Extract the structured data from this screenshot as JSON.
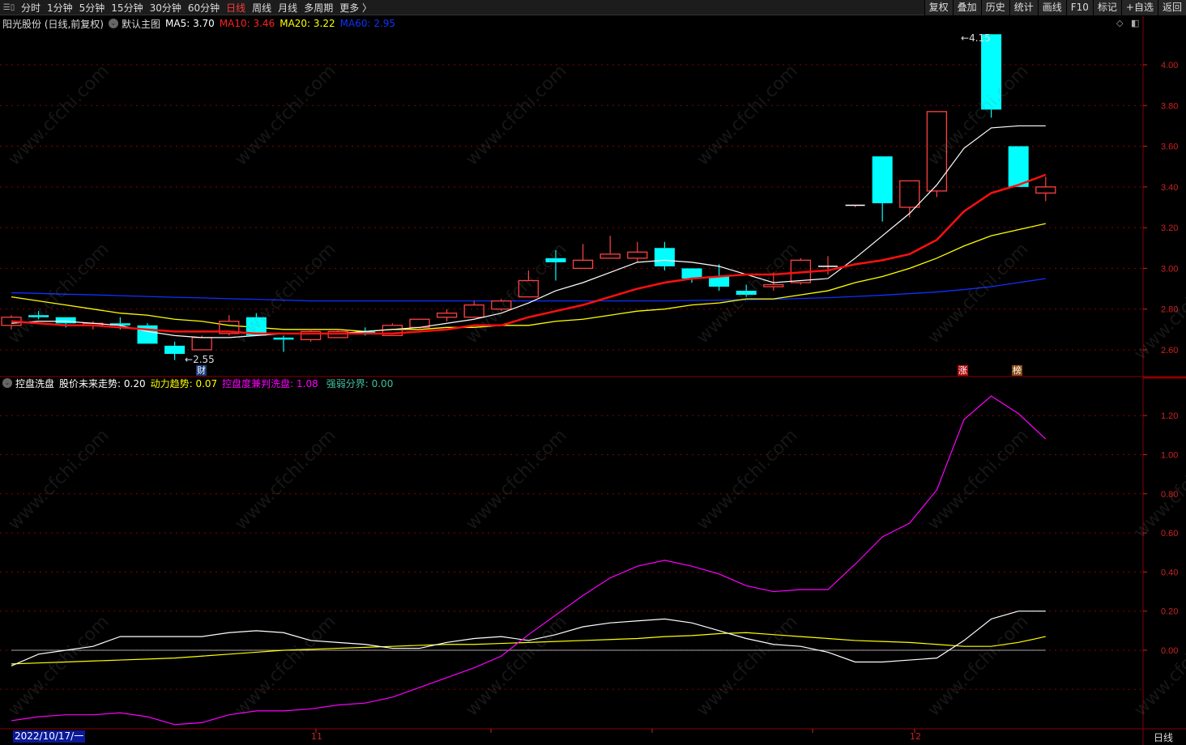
{
  "toolbar": {
    "left": [
      "分时",
      "1分钟",
      "5分钟",
      "15分钟",
      "30分钟",
      "60分钟",
      "日线",
      "周线",
      "月线",
      "多周期",
      "更多 〉"
    ],
    "active": "日线",
    "right": [
      "复权",
      "叠加",
      "历史",
      "统计",
      "画线",
      "F10",
      "标记",
      "+自选",
      "返回"
    ]
  },
  "main": {
    "title": "阳光股份 (日线,前复权)",
    "template": "默认主图",
    "ma": [
      {
        "label": "MA5: 3.70",
        "color": "#ffffff"
      },
      {
        "label": "MA10: 3.46",
        "color": "#ff2020"
      },
      {
        "label": "MA20: 3.22",
        "color": "#ffff00"
      },
      {
        "label": "MA60: 2.95",
        "color": "#1030ff"
      }
    ],
    "y_ticks": [
      "4.00",
      "3.80",
      "3.60",
      "3.40",
      "3.20",
      "3.00",
      "2.80",
      "2.60"
    ],
    "low_marker": "2.55",
    "high_marker": "4.15",
    "badges": [
      {
        "text": "财",
        "color": "#1a3a7a"
      },
      {
        "text": "涨",
        "color": "#b01010"
      },
      {
        "text": "榜",
        "color": "#8a4a10"
      }
    ]
  },
  "sub": {
    "title": "控盘洗盘",
    "items": [
      {
        "label": "股价未来走势: 0.20",
        "color": "#ffffff"
      },
      {
        "label": "动力趋势: 0.07",
        "color": "#ffff00"
      },
      {
        "label": "控盘度兼判洗盘: 1.08",
        "color": "#ff00ff"
      },
      {
        "label": "强弱分界: 0.00",
        "color": "#40c0a0"
      }
    ],
    "y_ticks": [
      "1.20",
      "1.00",
      "0.80",
      "0.60",
      "0.40",
      "0.20",
      "0.00"
    ]
  },
  "xaxis": {
    "date": "2022/10/17/一",
    "months": [
      "11",
      "12"
    ],
    "period": "日线"
  },
  "watermark": "www.cfchi.com",
  "colors": {
    "up": "#ff4040",
    "down": "#00ffff",
    "grid": "#8b0000"
  },
  "chart_data": {
    "type": "candlestick",
    "candles": [
      [
        2.72,
        2.76,
        2.77,
        2.7
      ],
      [
        2.77,
        2.76,
        2.79,
        2.75
      ],
      [
        2.76,
        2.73,
        2.76,
        2.71
      ],
      [
        2.72,
        2.73,
        2.74,
        2.7
      ],
      [
        2.73,
        2.72,
        2.76,
        2.7
      ],
      [
        2.72,
        2.63,
        2.73,
        2.63
      ],
      [
        2.62,
        2.58,
        2.64,
        2.55
      ],
      [
        2.6,
        2.66,
        2.67,
        2.6
      ],
      [
        2.68,
        2.74,
        2.77,
        2.67
      ],
      [
        2.76,
        2.67,
        2.78,
        2.67
      ],
      [
        2.66,
        2.65,
        2.67,
        2.59
      ],
      [
        2.65,
        2.69,
        2.7,
        2.64
      ],
      [
        2.66,
        2.69,
        2.7,
        2.66
      ],
      [
        2.69,
        2.68,
        2.71,
        2.67
      ],
      [
        2.67,
        2.72,
        2.73,
        2.67
      ],
      [
        2.71,
        2.75,
        2.75,
        2.7
      ],
      [
        2.76,
        2.78,
        2.8,
        2.74
      ],
      [
        2.76,
        2.82,
        2.84,
        2.76
      ],
      [
        2.8,
        2.84,
        2.85,
        2.79
      ],
      [
        2.86,
        2.94,
        2.99,
        2.86
      ],
      [
        3.05,
        3.03,
        3.09,
        2.94
      ],
      [
        3.0,
        3.04,
        3.12,
        3.0
      ],
      [
        3.05,
        3.07,
        3.16,
        3.05
      ],
      [
        3.05,
        3.08,
        3.13,
        3.03
      ],
      [
        3.1,
        3.01,
        3.13,
        2.99
      ],
      [
        3.0,
        2.95,
        3.0,
        2.93
      ],
      [
        2.96,
        2.91,
        3.02,
        2.89
      ],
      [
        2.89,
        2.87,
        2.92,
        2.86
      ],
      [
        2.91,
        2.92,
        2.98,
        2.89
      ],
      [
        2.93,
        3.04,
        3.05,
        2.92
      ],
      [
        3.01,
        3.01,
        3.06,
        2.97
      ],
      [
        3.31,
        3.31,
        3.31,
        3.3
      ],
      [
        3.55,
        3.32,
        3.55,
        3.23
      ],
      [
        3.3,
        3.43,
        3.43,
        3.25
      ],
      [
        3.38,
        3.77,
        3.77,
        3.35
      ],
      null,
      [
        4.15,
        3.78,
        4.15,
        3.74
      ],
      [
        3.6,
        3.4,
        3.6,
        3.4
      ],
      [
        3.37,
        3.4,
        3.45,
        3.33
      ]
    ],
    "ma5": [
      2.73,
      2.74,
      2.74,
      2.73,
      2.72,
      2.69,
      2.67,
      2.66,
      2.66,
      2.67,
      2.68,
      2.68,
      2.68,
      2.69,
      2.7,
      2.71,
      2.73,
      2.75,
      2.78,
      2.83,
      2.89,
      2.93,
      2.98,
      3.03,
      3.04,
      3.03,
      3.01,
      2.97,
      2.93,
      2.94,
      2.95,
      3.05,
      3.16,
      3.27,
      3.41,
      3.59,
      3.69,
      3.7,
      3.7
    ],
    "ma10": [
      2.74,
      2.73,
      2.72,
      2.72,
      2.71,
      2.7,
      2.69,
      2.69,
      2.69,
      2.68,
      2.68,
      2.68,
      2.68,
      2.68,
      2.68,
      2.69,
      2.7,
      2.72,
      2.72,
      2.76,
      2.79,
      2.82,
      2.86,
      2.9,
      2.93,
      2.95,
      2.96,
      2.97,
      2.97,
      2.98,
      2.99,
      3.02,
      3.04,
      3.07,
      3.14,
      3.28,
      3.37,
      3.41,
      3.46
    ],
    "ma20": [
      2.86,
      2.84,
      2.82,
      2.8,
      2.78,
      2.77,
      2.75,
      2.74,
      2.72,
      2.71,
      2.7,
      2.7,
      2.7,
      2.69,
      2.7,
      2.7,
      2.71,
      2.71,
      2.72,
      2.72,
      2.74,
      2.75,
      2.77,
      2.79,
      2.8,
      2.82,
      2.83,
      2.85,
      2.85,
      2.87,
      2.89,
      2.93,
      2.96,
      3.0,
      3.05,
      3.11,
      3.16,
      3.19,
      3.22
    ],
    "ma60": [
      2.88,
      2.877,
      2.873,
      2.87,
      2.866,
      2.862,
      2.858,
      2.855,
      2.851,
      2.848,
      2.844,
      2.84,
      2.84,
      2.84,
      2.84,
      2.84,
      2.84,
      2.84,
      2.84,
      2.84,
      2.84,
      2.84,
      2.84,
      2.84,
      2.84,
      2.842,
      2.844,
      2.846,
      2.848,
      2.852,
      2.856,
      2.862,
      2.868,
      2.876,
      2.884,
      2.896,
      2.91,
      2.93,
      2.95
    ],
    "sub_future": [
      -0.08,
      -0.02,
      0.0,
      0.02,
      0.07,
      0.07,
      0.07,
      0.07,
      0.09,
      0.1,
      0.09,
      0.05,
      0.04,
      0.03,
      0.01,
      0.01,
      0.04,
      0.06,
      0.07,
      0.05,
      0.08,
      0.12,
      0.14,
      0.15,
      0.16,
      0.14,
      0.1,
      0.06,
      0.03,
      0.02,
      -0.01,
      -0.06,
      -0.06,
      -0.05,
      -0.04,
      0.05,
      0.16,
      0.2,
      0.2
    ],
    "sub_power": [
      -0.07,
      -0.065,
      -0.06,
      -0.055,
      -0.05,
      -0.045,
      -0.04,
      -0.03,
      -0.02,
      -0.01,
      0.0,
      0.005,
      0.01,
      0.015,
      0.02,
      0.025,
      0.03,
      0.03,
      0.035,
      0.04,
      0.045,
      0.05,
      0.055,
      0.06,
      0.07,
      0.075,
      0.085,
      0.09,
      0.08,
      0.07,
      0.06,
      0.05,
      0.045,
      0.04,
      0.03,
      0.02,
      0.02,
      0.04,
      0.07
    ],
    "sub_control": [
      -0.36,
      -0.34,
      -0.33,
      -0.33,
      -0.32,
      -0.34,
      -0.38,
      -0.37,
      -0.33,
      -0.31,
      -0.31,
      -0.3,
      -0.28,
      -0.27,
      -0.24,
      -0.19,
      -0.14,
      -0.09,
      -0.03,
      0.08,
      0.18,
      0.28,
      0.37,
      0.43,
      0.46,
      0.43,
      0.39,
      0.33,
      0.3,
      0.31,
      0.31,
      0.44,
      0.58,
      0.65,
      0.82,
      1.18,
      1.3,
      1.21,
      1.08
    ],
    "sub_divide": 0.0,
    "main_ylim": [
      2.6,
      4.0
    ],
    "sub_ylim": [
      0.0,
      1.2
    ]
  }
}
